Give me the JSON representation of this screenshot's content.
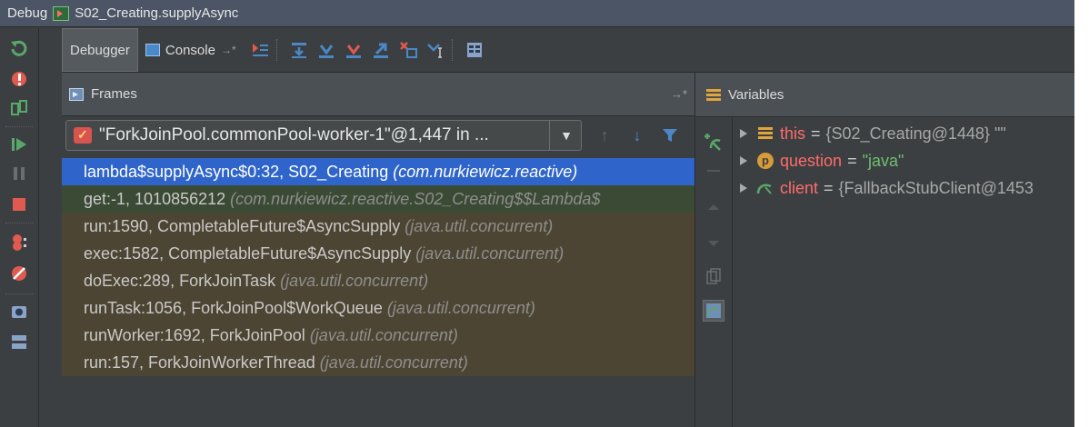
{
  "window": {
    "title_prefix": "Debug",
    "title": "S02_Creating.supplyAsync"
  },
  "toolbar": {
    "debugger_tab": "Debugger",
    "console_tab": "Console",
    "console_pin": "→*"
  },
  "frames": {
    "header": "Frames",
    "pin": "→*",
    "thread": "\"ForkJoinPool.commonPool-worker-1\"@1,447 in ...",
    "items": [
      {
        "method": "lambda$supplyAsync$0:32, S02_Creating",
        "location": "(com.nurkiewicz.reactive)"
      },
      {
        "method": "get:-1, 1010856212",
        "location": "(com.nurkiewicz.reactive.S02_Creating$$Lambda$"
      },
      {
        "method": "run:1590, CompletableFuture$AsyncSupply",
        "location": "(java.util.concurrent)"
      },
      {
        "method": "exec:1582, CompletableFuture$AsyncSupply",
        "location": "(java.util.concurrent)"
      },
      {
        "method": "doExec:289, ForkJoinTask",
        "location": "(java.util.concurrent)"
      },
      {
        "method": "runTask:1056, ForkJoinPool$WorkQueue",
        "location": "(java.util.concurrent)"
      },
      {
        "method": "runWorker:1692, ForkJoinPool",
        "location": "(java.util.concurrent)"
      },
      {
        "method": "run:157, ForkJoinWorkerThread",
        "location": "(java.util.concurrent)"
      }
    ]
  },
  "variables": {
    "header": "Variables",
    "items": [
      {
        "icon": "field-icon",
        "name": "this",
        "value": "{S02_Creating@1448} \"\""
      },
      {
        "icon": "parameter-icon",
        "name": "question",
        "value": "\"java\""
      },
      {
        "icon": "watch-icon",
        "name": "client",
        "value": "{FallbackStubClient@1453"
      }
    ],
    "param_badge": "p"
  },
  "colors": {
    "selection": "#2f65ca",
    "lib_frame": "#3b4a34",
    "dim_frame": "#4d4533",
    "var_name": "#ff6b6b",
    "string_value": "#6fbf6f"
  }
}
